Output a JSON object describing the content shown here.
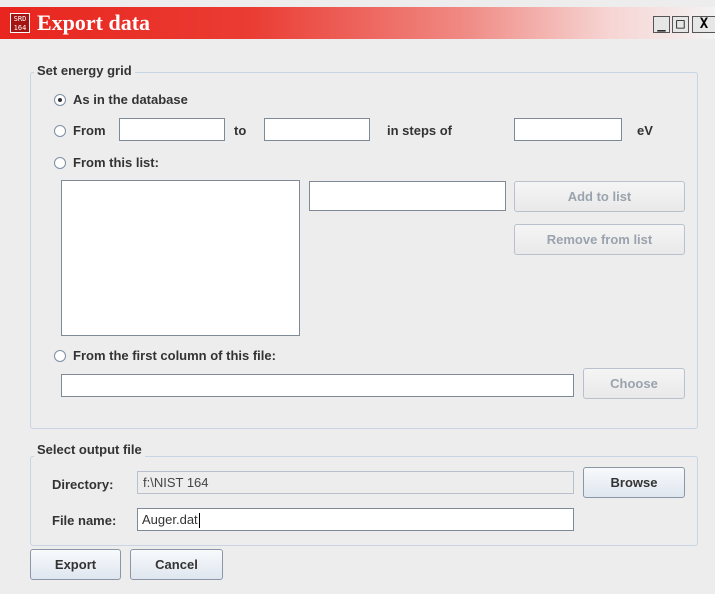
{
  "window": {
    "title": "Export data",
    "app_icon_text": [
      "SRD",
      "164"
    ],
    "controls": {
      "minimize": "_",
      "maximize": "□",
      "close": "X"
    }
  },
  "energy_grid": {
    "legend": "Set energy grid",
    "options": {
      "database": {
        "label": "As in the database",
        "selected": true
      },
      "range": {
        "label": "From",
        "to_label": "to",
        "steps_label": "in steps of",
        "unit": "eV",
        "from_value": "",
        "to_value": "",
        "step_value": ""
      },
      "list": {
        "label": "From this list:",
        "entry_value": "",
        "add_button": "Add to list",
        "remove_button": "Remove from list",
        "items": []
      },
      "file": {
        "label": "From the first column of this file:",
        "path_value": "",
        "choose_button": "Choose"
      }
    }
  },
  "output": {
    "legend": "Select output file",
    "directory_label": "Directory:",
    "directory_value": "f:\\NIST 164",
    "browse_button": "Browse",
    "filename_label": "File name:",
    "filename_value": "Auger.dat"
  },
  "actions": {
    "export_button": "Export",
    "cancel_button": "Cancel"
  },
  "colors": {
    "title_gradient_start": "#e8251e",
    "title_gradient_end": "#f3f3f3",
    "group_border": "#c9d5e4"
  }
}
